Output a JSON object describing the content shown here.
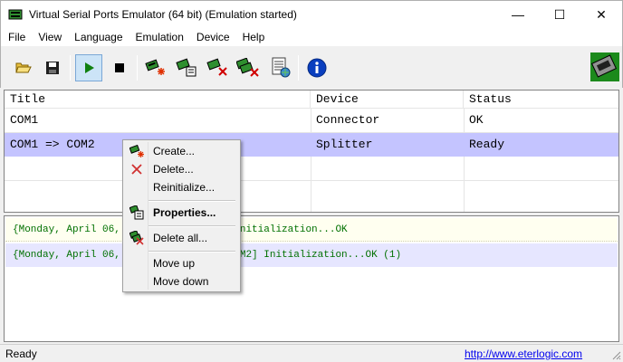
{
  "window": {
    "title": "Virtual Serial Ports Emulator (64 bit) (Emulation started)",
    "minimize": "—",
    "maximize": "☐",
    "close": "✕"
  },
  "menu": [
    "File",
    "View",
    "Language",
    "Emulation",
    "Device",
    "Help"
  ],
  "toolbar": {
    "icons": [
      "open-folder-icon",
      "save-icon",
      "play-icon",
      "stop-icon",
      "create-device-icon",
      "properties-device-icon",
      "delete-device-icon",
      "delete-all-icon",
      "log-icon",
      "info-icon",
      "serial-connector-logo"
    ],
    "play_active": true
  },
  "list": {
    "headers": [
      "Title",
      "Device",
      "Status"
    ],
    "rows": [
      {
        "title": "COM1",
        "device": "Connector",
        "status": "OK"
      },
      {
        "title": "COM1 => COM2",
        "device": "Splitter",
        "status": "Ready"
      }
    ]
  },
  "log": {
    "lines": [
      "{Monday, April 06,                    nitialization...OK",
      "{Monday, April 06,                    M2] Initialization...OK (1)"
    ]
  },
  "context_menu": {
    "items": [
      "Create...",
      "Delete...",
      "Reinitialize...",
      "Properties...",
      "Delete all...",
      "Move up",
      "Move down"
    ]
  },
  "status": {
    "text": "Ready",
    "link": "http://www.eterlogic.com"
  },
  "colors": {
    "selection": "#c4c4ff",
    "log_text": "#007000",
    "link": "#0000ee"
  }
}
